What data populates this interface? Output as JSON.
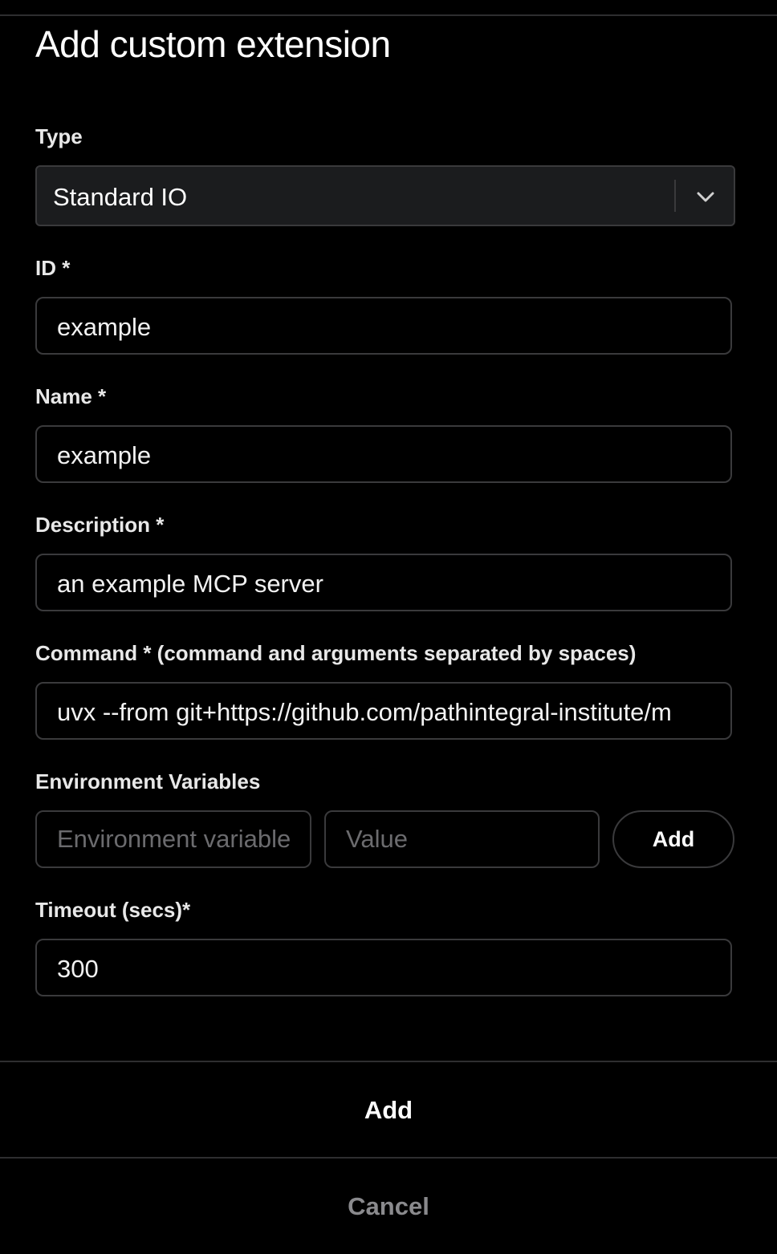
{
  "dialog": {
    "title": "Add custom extension"
  },
  "type_field": {
    "label": "Type",
    "selected": "Standard IO"
  },
  "id_field": {
    "label": "ID *",
    "value": "example"
  },
  "name_field": {
    "label": "Name *",
    "value": "example"
  },
  "description_field": {
    "label": "Description *",
    "value": "an example MCP server"
  },
  "command_field": {
    "label": "Command * (command and arguments separated by spaces)",
    "value": "uvx --from git+https://github.com/pathintegral-institute/m"
  },
  "env_vars": {
    "label": "Environment Variables",
    "name_placeholder": "Environment variable",
    "value_placeholder": "Value",
    "add_label": "Add"
  },
  "timeout_field": {
    "label": "Timeout (secs)*",
    "value": "300"
  },
  "footer": {
    "add_label": "Add",
    "cancel_label": "Cancel"
  },
  "icons": {
    "select_chevron": "chevron-down-icon"
  },
  "colors": {
    "background": "#000000",
    "border": "#3a3a3c",
    "select_background": "#1b1c1e",
    "text": "#ffffff",
    "placeholder": "#6b6b6e",
    "cancel_text": "#8a8a8d"
  }
}
